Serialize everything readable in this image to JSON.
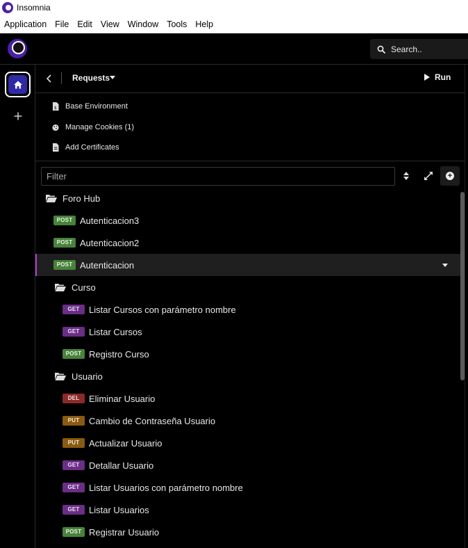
{
  "window": {
    "title": "Insomnia"
  },
  "menu": [
    "Application",
    "File",
    "Edit",
    "View",
    "Window",
    "Tools",
    "Help"
  ],
  "header": {
    "search_label": "Search.."
  },
  "panel": {
    "title": "Requests",
    "run_label": "Run",
    "environment_items": [
      {
        "label": "Base Environment",
        "icon": "environment-icon"
      },
      {
        "label": "Manage Cookies (1)",
        "icon": "cookie-icon"
      },
      {
        "label": "Add Certificates",
        "icon": "certificate-icon"
      }
    ],
    "filter_placeholder": "Filter"
  },
  "tree": {
    "folder_root": "Foro Hub",
    "root_requests": [
      {
        "method": "POST",
        "name": "Autenticacion3"
      },
      {
        "method": "POST",
        "name": "Autenticacion2"
      },
      {
        "method": "POST",
        "name": "Autenticacion",
        "active": true
      }
    ],
    "folder_curso": "Curso",
    "curso_requests": [
      {
        "method": "GET",
        "name": "Listar Cursos con parámetro nombre"
      },
      {
        "method": "GET",
        "name": "Listar Cursos"
      },
      {
        "method": "POST",
        "name": "Registro Curso"
      }
    ],
    "folder_usuario": "Usuario",
    "usuario_requests": [
      {
        "method": "DEL",
        "name": "Eliminar Usuario"
      },
      {
        "method": "PUT",
        "name": "Cambio de Contraseña Usuario"
      },
      {
        "method": "PUT",
        "name": "Actualizar Usuario"
      },
      {
        "method": "GET",
        "name": "Detallar Usuario"
      },
      {
        "method": "GET",
        "name": "Listar Usuarios con parámetro nombre"
      },
      {
        "method": "GET",
        "name": "Listar Usuarios"
      },
      {
        "method": "POST",
        "name": "Registrar Usuario"
      }
    ]
  },
  "colors": {
    "accent": "#4b1fa8",
    "active_indicator": "#b43cd8",
    "post": "#48823c",
    "get": "#6a2e86",
    "del": "#8b2a2a",
    "put": "#8a5a12"
  }
}
